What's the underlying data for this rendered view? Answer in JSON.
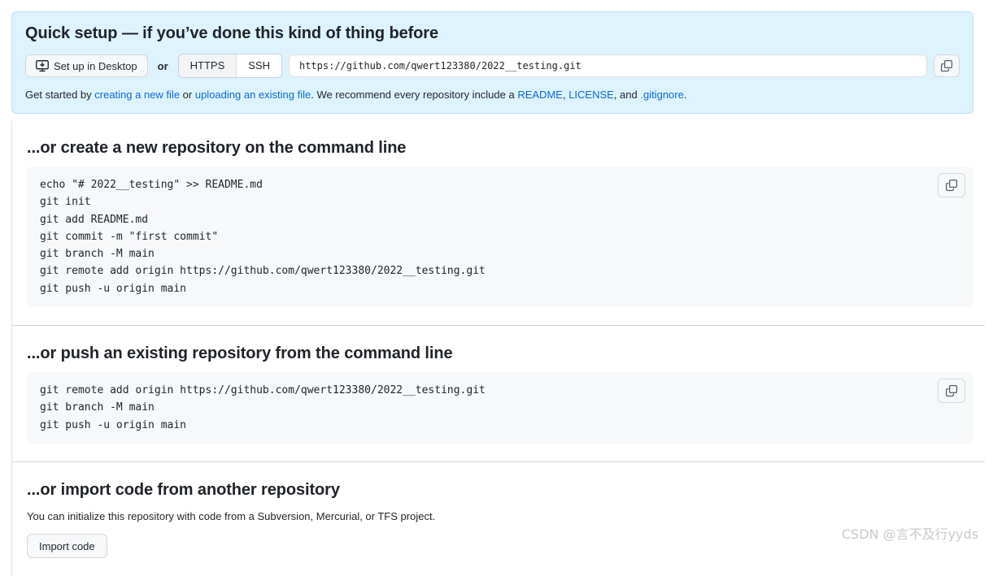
{
  "quick_setup": {
    "title": "Quick setup — if you’ve done this kind of thing before",
    "desktop_button": "Set up in Desktop",
    "or_label": "or",
    "protocols": [
      "HTTPS",
      "SSH"
    ],
    "selected_protocol": "HTTPS",
    "clone_url": "https://github.com/qwert123380/2022__testing.git",
    "get_started": {
      "prefix": "Get started by ",
      "link_create": "creating a new file",
      "mid1": " or ",
      "link_upload": "uploading an existing file",
      "mid2": ". We recommend every repository include a ",
      "link_readme": "README",
      "comma1": ", ",
      "link_license": "LICENSE",
      "mid3": ", and ",
      "link_gitignore": ".gitignore",
      "suffix": "."
    }
  },
  "sections": {
    "create_new": {
      "heading": "...or create a new repository on the command line",
      "code": "echo \"# 2022__testing\" >> README.md\ngit init\ngit add README.md\ngit commit -m \"first commit\"\ngit branch -M main\ngit remote add origin https://github.com/qwert123380/2022__testing.git\ngit push -u origin main"
    },
    "push_existing": {
      "heading": "...or push an existing repository from the command line",
      "code": "git remote add origin https://github.com/qwert123380/2022__testing.git\ngit branch -M main\ngit push -u origin main"
    },
    "import_code": {
      "heading": "...or import code from another repository",
      "description": "You can initialize this repository with code from a Subversion, Mercurial, or TFS project.",
      "button": "Import code"
    }
  },
  "watermark": "CSDN @言不及行yyds",
  "colors": {
    "banner_bg": "#ddf4ff",
    "banner_border": "#b6e3ff",
    "link": "#0969da",
    "code_bg": "#f6f8fa",
    "text": "#1f2328",
    "divider": "#d0d7de"
  }
}
